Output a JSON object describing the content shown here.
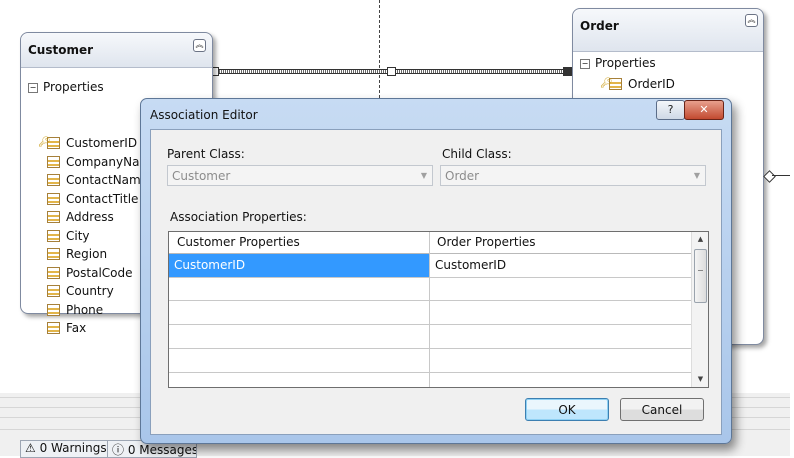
{
  "designer": {
    "customer": {
      "title": "Customer",
      "section": "Properties",
      "properties": [
        "CustomerID",
        "CompanyName",
        "ContactName",
        "ContactTitle",
        "Address",
        "City",
        "Region",
        "PostalCode",
        "Country",
        "Phone",
        "Fax"
      ]
    },
    "order": {
      "title": "Order",
      "section": "Properties",
      "properties": [
        "OrderID"
      ]
    }
  },
  "dialog": {
    "title": "Association Editor",
    "help_glyph": "?",
    "close_glyph": "✕",
    "parent_label": "Parent Class:",
    "parent_value": "Customer",
    "child_label": "Child Class:",
    "child_value": "Order",
    "props_label": "Association Properties:",
    "grid": {
      "columns": [
        "Customer Properties",
        "Order Properties"
      ],
      "rows": [
        [
          "CustomerID",
          "CustomerID"
        ]
      ]
    },
    "ok_label": "OK",
    "cancel_label": "Cancel"
  },
  "bottom": {
    "tab1": "0 Warnings",
    "tab2": "0 Messages"
  }
}
